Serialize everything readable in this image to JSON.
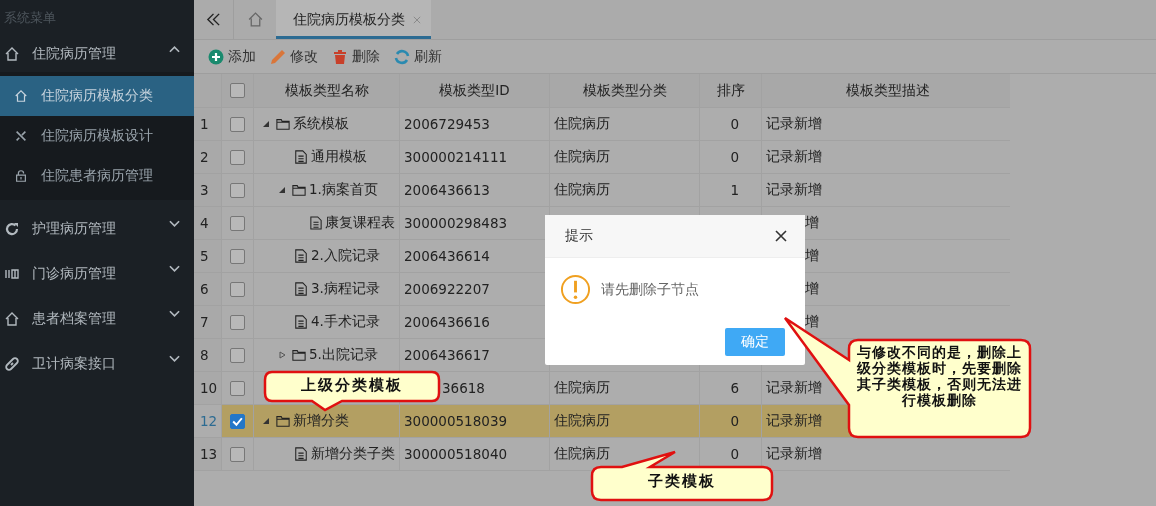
{
  "sidebar": {
    "title": "系统菜单",
    "groups": [
      {
        "label": "住院病历管理",
        "expanded": true,
        "items": [
          {
            "label": "住院病历模板分类",
            "selected": true
          },
          {
            "label": "住院病历模板设计",
            "selected": false
          },
          {
            "label": "住院患者病历管理",
            "selected": false
          }
        ]
      },
      {
        "label": "护理病历管理",
        "expanded": false
      },
      {
        "label": "门诊病历管理",
        "expanded": false
      },
      {
        "label": "患者档案管理",
        "expanded": false
      },
      {
        "label": "卫计病案接口",
        "expanded": false
      }
    ]
  },
  "tabs": [
    {
      "label": "住院病历模板分类",
      "selected": true
    }
  ],
  "toolbar": [
    "添加",
    "修改",
    "删除",
    "刷新"
  ],
  "table": {
    "select_all_checked": false,
    "columns": [
      "模板类型名称",
      "模板类型ID",
      "模板类型分类",
      "排序",
      "模板类型描述"
    ],
    "rows": [
      {
        "num": "1",
        "checked": false,
        "selected": false,
        "kind": "folder",
        "expanded": true,
        "name": "系统模板",
        "id": "2006729453",
        "category": "住院病历",
        "order": "0",
        "description": "记录新增",
        "children": [
          {
            "num": "2",
            "checked": false,
            "selected": false,
            "kind": "file",
            "name": "通用模板",
            "id": "300000214111",
            "category": "住院病历",
            "order": "0",
            "description": "记录新增"
          },
          {
            "num": "3",
            "checked": false,
            "selected": false,
            "kind": "folder",
            "expanded": true,
            "name": "1.病案首页",
            "id": "2006436613",
            "category": "住院病历",
            "order": "1",
            "description": "记录新增",
            "children": [
              {
                "num": "4",
                "checked": false,
                "selected": false,
                "kind": "file",
                "name": "康复课程表",
                "id": "300000298483",
                "description": "增"
              }
            ]
          },
          {
            "num": "5",
            "checked": false,
            "selected": false,
            "kind": "file",
            "name": "2.入院记录",
            "id": "2006436614",
            "description": "增"
          },
          {
            "num": "6",
            "checked": false,
            "selected": false,
            "kind": "file",
            "name": "3.病程记录",
            "id": "2006922207",
            "description": "增"
          },
          {
            "num": "7",
            "checked": false,
            "selected": false,
            "kind": "file",
            "name": "4.手术记录",
            "id": "2006436616",
            "description": "增"
          },
          {
            "num": "8",
            "checked": false,
            "selected": false,
            "kind": "folder",
            "expanded": false,
            "name": "5.出院记录",
            "id": "2006436617"
          },
          {
            "num": "10",
            "checked": false,
            "selected": false,
            "id": "36618",
            "category": "住院病历",
            "order": "6",
            "description": "记录新增"
          }
        ]
      },
      {
        "num": "12",
        "checked": true,
        "selected": true,
        "kind": "folder",
        "expanded": true,
        "name": "新增分类",
        "id": "300000518039",
        "category": "住院病历",
        "order": "0",
        "description": "记录新增",
        "children": [
          {
            "num": "13",
            "checked": false,
            "selected": false,
            "kind": "file",
            "name": "新增分类子类",
            "id": "300000518040",
            "category": "住院病历",
            "order": "0",
            "description": "记录新增"
          }
        ]
      }
    ]
  },
  "dialog": {
    "title": "提示",
    "message": "请先删除子节点",
    "button": "确定"
  },
  "callouts": [
    "上级分类模板",
    "与修改不同的是，删除上级分类模板时，先要删除其子类模板，否则无法进行模板删除",
    "子类模板"
  ]
}
